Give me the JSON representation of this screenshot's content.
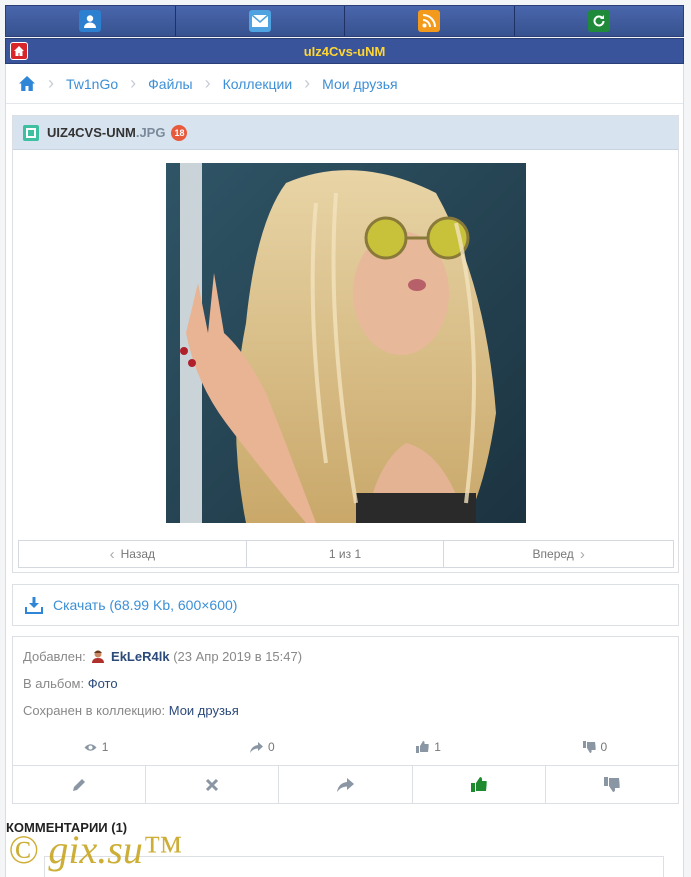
{
  "header": {
    "title": "uIz4Cvs-uNM",
    "icons": [
      "user-icon",
      "mail-icon",
      "rss-icon",
      "refresh-icon"
    ]
  },
  "breadcrumb": {
    "items": [
      "Tw1nGo",
      "Файлы",
      "Коллекции",
      "Мои друзья"
    ]
  },
  "file": {
    "name": "UIZ4CVS-UNM",
    "ext": ".JPG",
    "age_badge": "18"
  },
  "pager": {
    "prev": "Назад",
    "position": "1 из 1",
    "next": "Вперед"
  },
  "download": {
    "label": "Скачать (68.99 Kb, 600×600)"
  },
  "info": {
    "added_label": "Добавлен:",
    "user": "EkLeR4lk",
    "added_date": "(23 Апр 2019 в 15:47)",
    "album_label": "В альбом:",
    "album": "Фото",
    "collection_label": "Сохранен в коллекцию:",
    "collection": "Мои друзья"
  },
  "stats": {
    "views": "1",
    "shares": "0",
    "likes": "1",
    "dislikes": "0"
  },
  "comments": {
    "title": "Комментарии (1)"
  },
  "watermark": "© gix.su™",
  "colors": {
    "nav_bg": "#39549a",
    "title_text": "#ffd633",
    "link": "#3c8fd6",
    "like_active": "#1f8a2e"
  }
}
